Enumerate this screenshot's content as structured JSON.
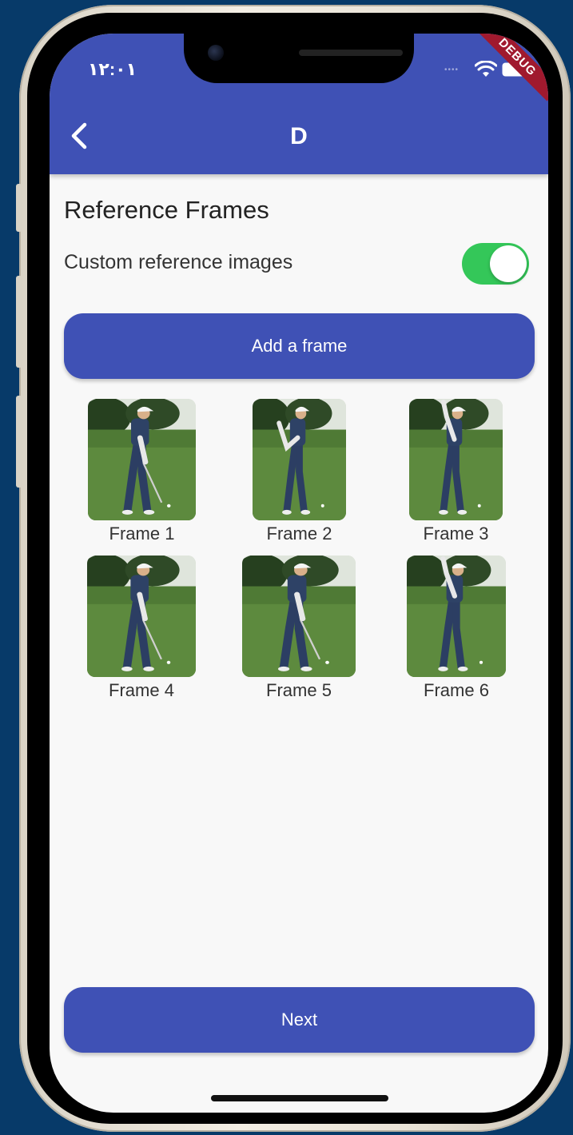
{
  "status_bar": {
    "time": "١٢:٠١",
    "debug_banner": "DEBUG"
  },
  "app_bar": {
    "title": "D"
  },
  "page": {
    "section_title": "Reference Frames",
    "custom_toggle": {
      "label": "Custom reference images",
      "on": true
    },
    "add_button": "Add a frame",
    "next_button": "Next"
  },
  "frames": [
    {
      "label": "Frame 1"
    },
    {
      "label": "Frame 2"
    },
    {
      "label": "Frame 3"
    },
    {
      "label": "Frame 4"
    },
    {
      "label": "Frame 5"
    },
    {
      "label": "Frame 6"
    }
  ],
  "colors": {
    "primary": "#3f51b5",
    "toggle_on": "#34c759",
    "background": "#073a69",
    "debug": "#a0192e"
  }
}
